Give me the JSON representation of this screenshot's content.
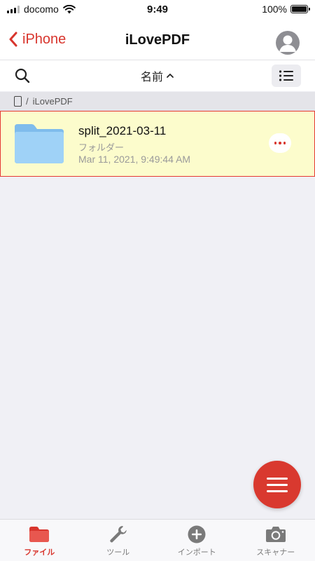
{
  "status_bar": {
    "carrier": "docomo",
    "time": "9:49",
    "battery_percent": "100%",
    "battery_level": 1.0
  },
  "nav": {
    "back_label": "iPhone",
    "title": "iLovePDF"
  },
  "toolbar": {
    "sort_label": "名前"
  },
  "breadcrumb": {
    "separator": "/",
    "folder": "iLovePDF"
  },
  "files": [
    {
      "name": "split_2021-03-11",
      "type": "フォルダー",
      "date": "Mar 11, 2021, 9:49:44 AM"
    }
  ],
  "tabs": [
    {
      "label": "ファイル",
      "icon": "folder-icon",
      "active": true
    },
    {
      "label": "ツール",
      "icon": "wrench-icon",
      "active": false
    },
    {
      "label": "インポート",
      "icon": "plus-circle-icon",
      "active": false
    },
    {
      "label": "スキャナー",
      "icon": "camera-icon",
      "active": false
    }
  ],
  "colors": {
    "accent": "#d8352d",
    "selected_row_bg": "#fcfccc",
    "folder": "#8cc8f5"
  }
}
